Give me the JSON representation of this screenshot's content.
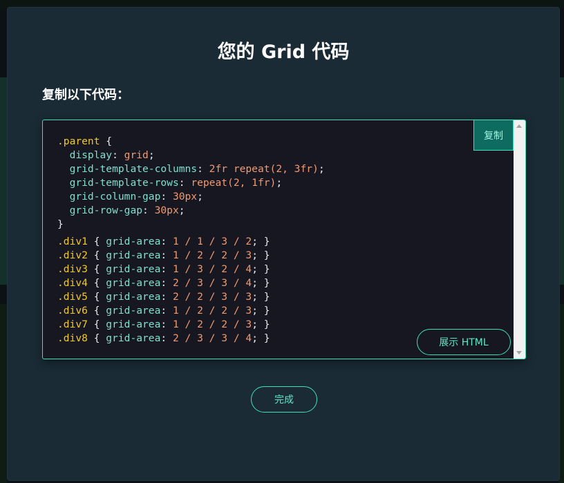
{
  "modal": {
    "title": "您的 Grid 代码",
    "subtitle": "复制以下代码：",
    "copy_label": "复制",
    "show_html_label": "展示 HTML",
    "done_label": "完成"
  },
  "code": {
    "parent_selector": ".parent",
    "open_brace": " {",
    "close_brace": "}",
    "declarations": [
      {
        "prop": "display",
        "value": "grid"
      },
      {
        "prop": "grid-template-columns",
        "value": "2fr repeat(2, 3fr)"
      },
      {
        "prop": "grid-template-rows",
        "value": "repeat(2, 1fr)"
      },
      {
        "prop": "grid-column-gap",
        "value": "30px"
      },
      {
        "prop": "grid-row-gap",
        "value": "30px"
      }
    ],
    "divs": [
      {
        "selector": ".div1",
        "prop": "grid-area",
        "value": "1 / 1 / 3 / 2"
      },
      {
        "selector": ".div2",
        "prop": "grid-area",
        "value": "1 / 2 / 2 / 3"
      },
      {
        "selector": ".div3",
        "prop": "grid-area",
        "value": "1 / 3 / 2 / 4"
      },
      {
        "selector": ".div4",
        "prop": "grid-area",
        "value": "2 / 3 / 3 / 4"
      },
      {
        "selector": ".div5",
        "prop": "grid-area",
        "value": "2 / 2 / 3 / 3"
      },
      {
        "selector": ".div6",
        "prop": "grid-area",
        "value": "1 / 2 / 2 / 3"
      },
      {
        "selector": ".div7",
        "prop": "grid-area",
        "value": "1 / 2 / 2 / 3"
      },
      {
        "selector": ".div8",
        "prop": "grid-area",
        "value": "2 / 3 / 3 / 4"
      }
    ]
  },
  "colors": {
    "modal_bg": "#1a2b35",
    "code_bg": "#171721",
    "accent": "#3fe0b8",
    "selector": "#f3c82c",
    "property": "#7fe0cf",
    "value": "#f19a6f"
  }
}
